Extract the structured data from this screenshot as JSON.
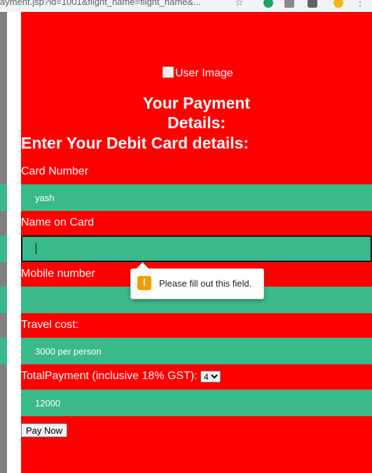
{
  "browser": {
    "url": "ayment.jsp?id=1001&flight_name=flight_name&..."
  },
  "page": {
    "user_image_alt": "User Image",
    "title": "Your Payment Details:",
    "subtitle": "Enter Your Debit Card details:"
  },
  "form": {
    "card_number_label": "Card Number",
    "card_number_value": "yash",
    "name_on_card_label": "Name on Card",
    "name_on_card_value": "",
    "mobile_label": "Mobile number",
    "mobile_value": "",
    "travel_cost_label": "Travel cost:",
    "travel_cost_value": "3000 per person",
    "total_label": "TotalPayment (inclusive 18% GST):",
    "total_select_value": "4",
    "total_value": "12000",
    "pay_button": "Pay Now"
  },
  "validation": {
    "message": "Please fill out this field.",
    "icon": "warning-icon"
  },
  "colors": {
    "page_bg": "#ff0000",
    "field_bg": "#3ab98a",
    "warning": "#f59c00"
  }
}
